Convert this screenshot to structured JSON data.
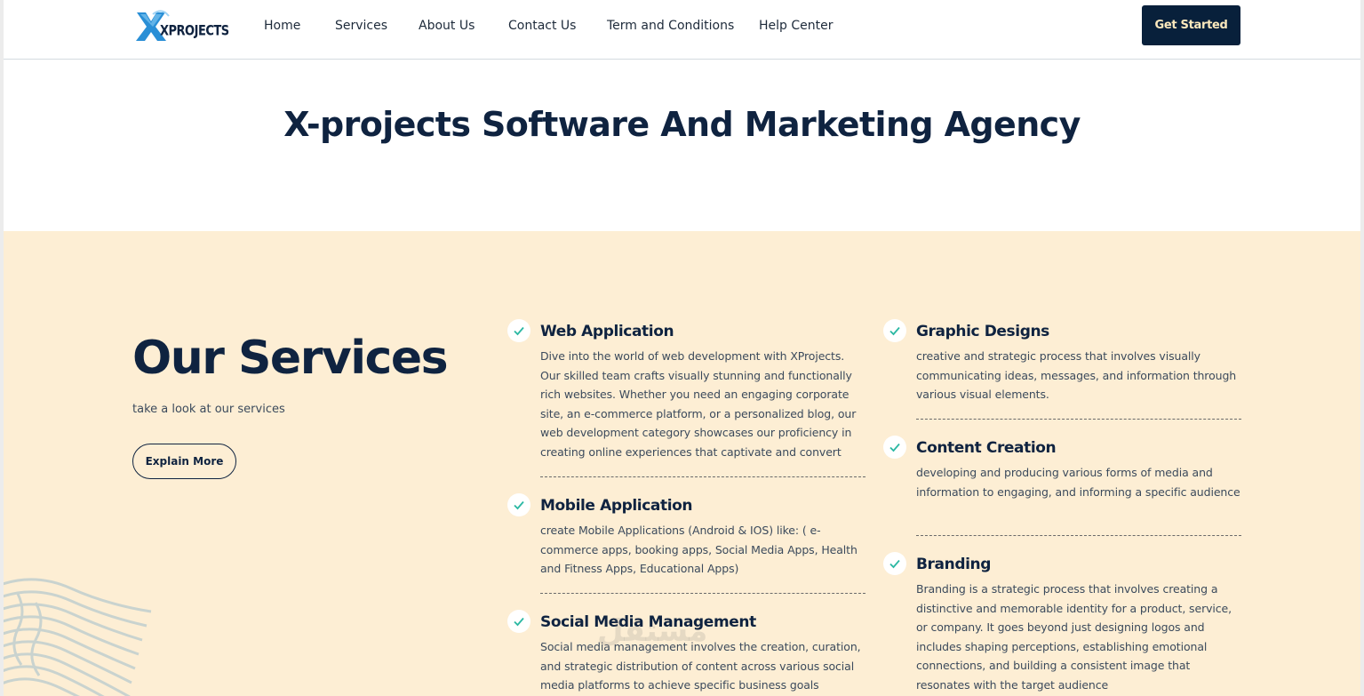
{
  "header": {
    "logo_text": "XPROJECTS",
    "nav": [
      {
        "label": "Home"
      },
      {
        "label": "Services"
      },
      {
        "label": "About Us"
      },
      {
        "label": "Contact Us"
      },
      {
        "label": "Term and Conditions"
      },
      {
        "label": "Help Center"
      }
    ],
    "cta_label": "Get Started"
  },
  "hero": {
    "title": "X-projects Software And Marketing Agency"
  },
  "services": {
    "title": "Our Services",
    "subtitle": "take a look at our services",
    "explain_label": "Explain More",
    "items": [
      {
        "title": "Web Application",
        "description": "Dive into the world of web development with XProjects. Our skilled team crafts visually stunning and functionally rich websites. Whether you need an engaging corporate site, an e-commerce platform, or a personalized blog, our web development category showcases our proficiency in creating online experiences that captivate and convert"
      },
      {
        "title": "Mobile Application",
        "description": "create Mobile Applications (Android & IOS) like: ( e-commerce apps, booking apps, Social Media Apps, Health and Fitness Apps, Educational Apps)"
      },
      {
        "title": "Social Media Management",
        "description": "Social media management involves the creation, curation, and strategic distribution of content across various social media platforms to achieve specific business goals"
      },
      {
        "title": "Graphic Designs",
        "description": "creative and strategic process that involves visually communicating ideas, messages, and information through various visual elements."
      },
      {
        "title": "Content Creation",
        "description": "developing and producing various forms of media and information to engaging, and informing a specific audience"
      },
      {
        "title": "Branding",
        "description": "Branding is a strategic process that involves creating a distinctive and memorable identity for a product, service, or company. It goes beyond just designing logos and includes shaping perceptions, establishing emotional connections, and building a consistent image that resonates with the target audience"
      }
    ]
  },
  "colors": {
    "navy": "#0f2340",
    "cream": "#fdeed4",
    "check_teal": "#2bb8a3",
    "logo_blue": "#2a8fd6"
  },
  "icons": {
    "check": "check-icon",
    "logo": "xprojects-logo-icon"
  },
  "watermark": "مستقل"
}
